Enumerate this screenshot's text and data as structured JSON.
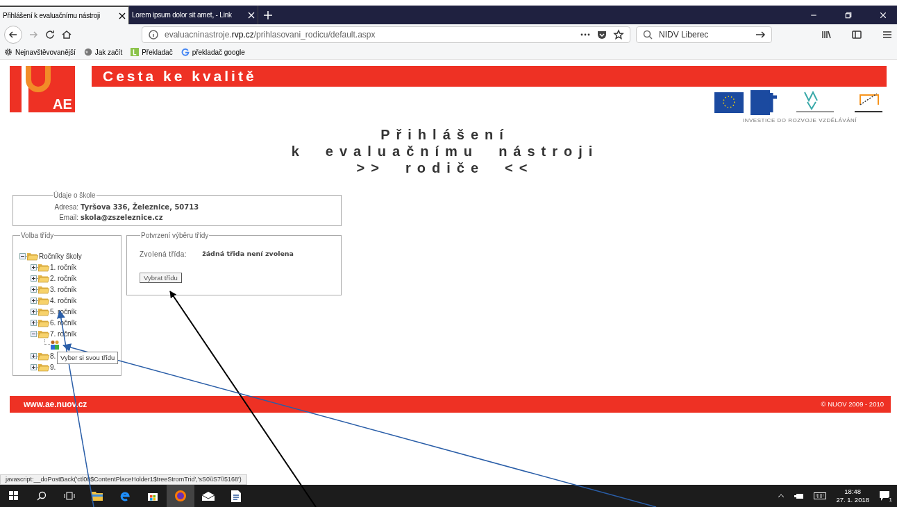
{
  "browser": {
    "tabs": [
      {
        "label": "Přihlášení k evaluačnímu nástroji",
        "selected": true
      },
      {
        "label": "Lorem ipsum dolor sit amet, - Link",
        "selected": false
      }
    ],
    "url": {
      "host": "evaluacninastroje.",
      "domain": "rvp.cz",
      "path": "/prihlasovani_rodicu/default.aspx"
    },
    "search": {
      "value": "NIDV Liberec"
    },
    "bookmarks": [
      {
        "kind": "gear",
        "label": "Nejnavštěvovanější"
      },
      {
        "kind": "globe",
        "label": "Jak začít"
      },
      {
        "kind": "translator",
        "label": "Překladač"
      },
      {
        "kind": "google",
        "label": "překladač google"
      }
    ]
  },
  "page": {
    "banner_title": "Cesta ke kvalitě",
    "logo_text": "AE",
    "sponsor_caption": "INVESTICE DO ROZVOJE VZDĚLÁVÁNÍ",
    "heading": [
      "Přihlášení",
      "k evaluačnímu nástroji",
      ">> rodiče <<"
    ],
    "school": {
      "legend": "Údaje o škole",
      "fields": [
        {
          "label": "Adresa:",
          "value": "Tyršova 336, Železnice, 50713"
        },
        {
          "label": "Email:",
          "value": "skola@zszeleznice.cz"
        }
      ]
    },
    "class_choice": {
      "legend": "Volba třídy",
      "tree": {
        "label": "Ročníky školy",
        "expanded": true,
        "children": [
          {
            "label": "1. ročník",
            "expanded": false
          },
          {
            "label": "2. ročník",
            "expanded": false
          },
          {
            "label": "3. ročník",
            "expanded": false
          },
          {
            "label": "4. ročník",
            "expanded": false
          },
          {
            "label": "5. ročník",
            "expanded": false
          },
          {
            "label": "6. ročník",
            "expanded": false
          },
          {
            "label": "7. ročník",
            "expanded": true,
            "children": [
              {
                "kind": "class"
              }
            ]
          },
          {
            "label": "8.",
            "expanded": false
          },
          {
            "label": "9.",
            "expanded": false
          }
        ]
      },
      "tooltip": "Vyber si svou třídu"
    },
    "confirmation": {
      "legend": "Potvrzení výběru třídy",
      "label": "Zvolená třída:",
      "value": "žádná třida není zvolena",
      "button": "Vybrat třídu"
    },
    "footer": {
      "left": "www.ae.nuov.cz",
      "right": "© NUOV 2009 - 2010"
    }
  },
  "status_bar": "javascript:__doPostBack('ctl00$ContentPlaceHolder1$treeStromTrid','sS0\\\\S7\\\\5168')",
  "taskbar": {
    "time": "18:48",
    "date": "27. 1. 2018",
    "notifications": "1"
  }
}
